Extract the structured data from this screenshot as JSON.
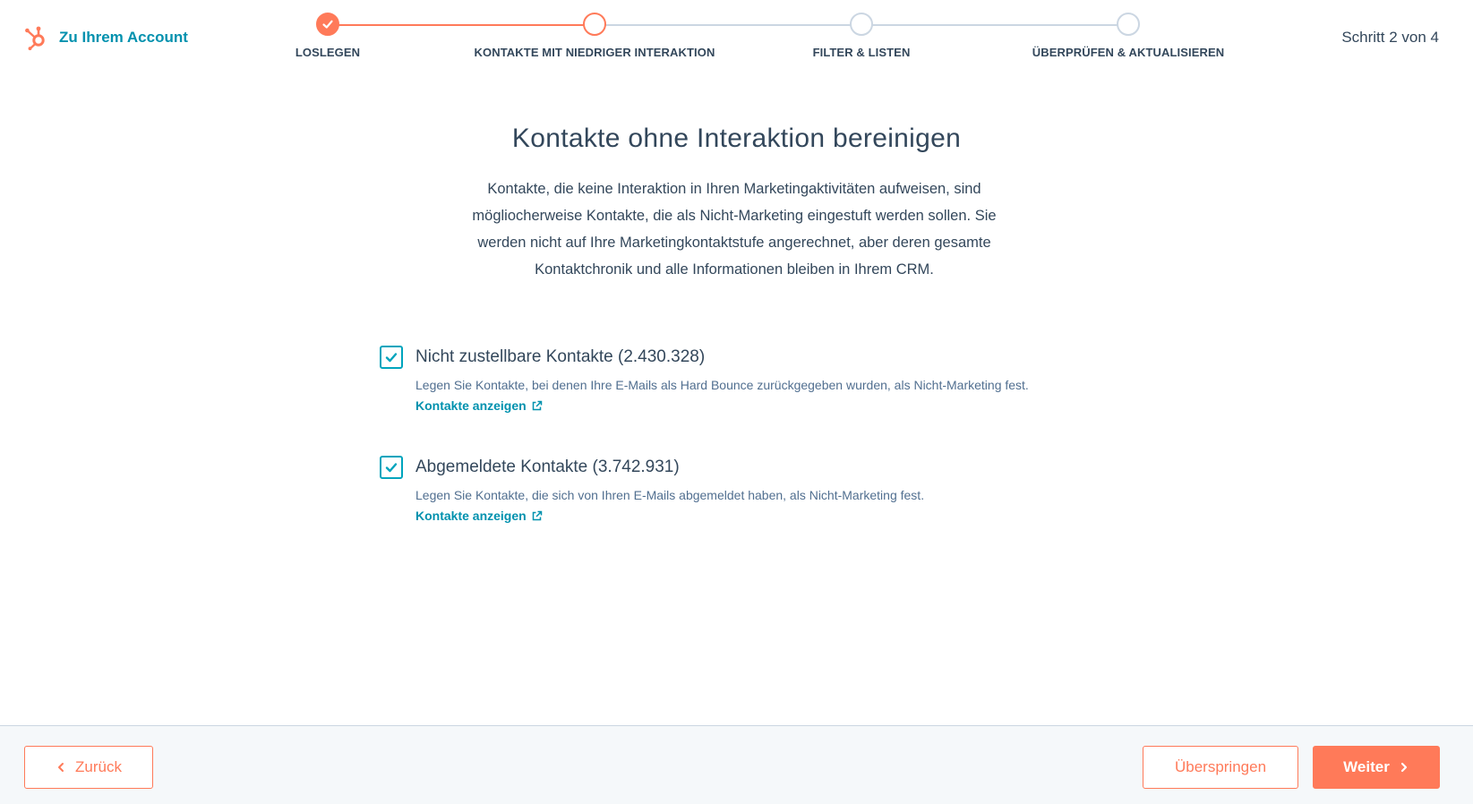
{
  "header": {
    "back_label": "Zu Ihrem Account",
    "step_counter": "Schritt 2 von 4"
  },
  "steps": [
    {
      "label": "LOSLEGEN",
      "state": "done"
    },
    {
      "label": "KONTAKTE MIT NIEDRIGER INTERAKTION",
      "state": "current"
    },
    {
      "label": "FILTER & LISTEN",
      "state": "upcoming"
    },
    {
      "label": "ÜBERPRÜFEN & AKTUALISIEREN",
      "state": "upcoming"
    }
  ],
  "main": {
    "title": "Kontakte ohne Interaktion bereinigen",
    "intro_lines": [
      "Kontakte, die keine Interaktion in Ihren Marketingaktivitäten aufweisen, sind",
      "mögliocherweise Kontakte, die als Nicht-Marketing eingestuft werden sollen. Sie",
      "werden nicht auf Ihre Marketingkontaktstufe angerechnet, aber deren gesamte",
      "Kontaktchronik und alle Informationen bleiben in Ihrem CRM."
    ],
    "options": [
      {
        "title": "Nicht zustellbare Kontakte (2.430.328)",
        "description": "Legen Sie Kontakte, bei denen Ihre E-Mails als Hard Bounce zurückgegeben wurden, als Nicht-Marketing fest.",
        "link": "Kontakte anzeigen",
        "checked": true
      },
      {
        "title": "Abgemeldete Kontakte (3.742.931)",
        "description": "Legen Sie Kontakte, die sich von Ihren E-Mails abgemeldet haben, als Nicht-Marketing fest.",
        "link": "Kontakte anzeigen",
        "checked": true
      }
    ]
  },
  "footer": {
    "back_label": "Zurück",
    "skip_label": "Überspringen",
    "next_label": "Weiter"
  },
  "colors": {
    "accent": "#ff7a59",
    "link": "#0091ae",
    "checkbox": "#00a4bd",
    "text": "#33475b",
    "track_inactive": "#cbd6e2"
  },
  "icons": {
    "logo": "hubspot-sprocket-icon",
    "check": "check-icon",
    "external": "external-link-icon",
    "left": "chevron-left-icon",
    "right": "chevron-right-icon"
  }
}
